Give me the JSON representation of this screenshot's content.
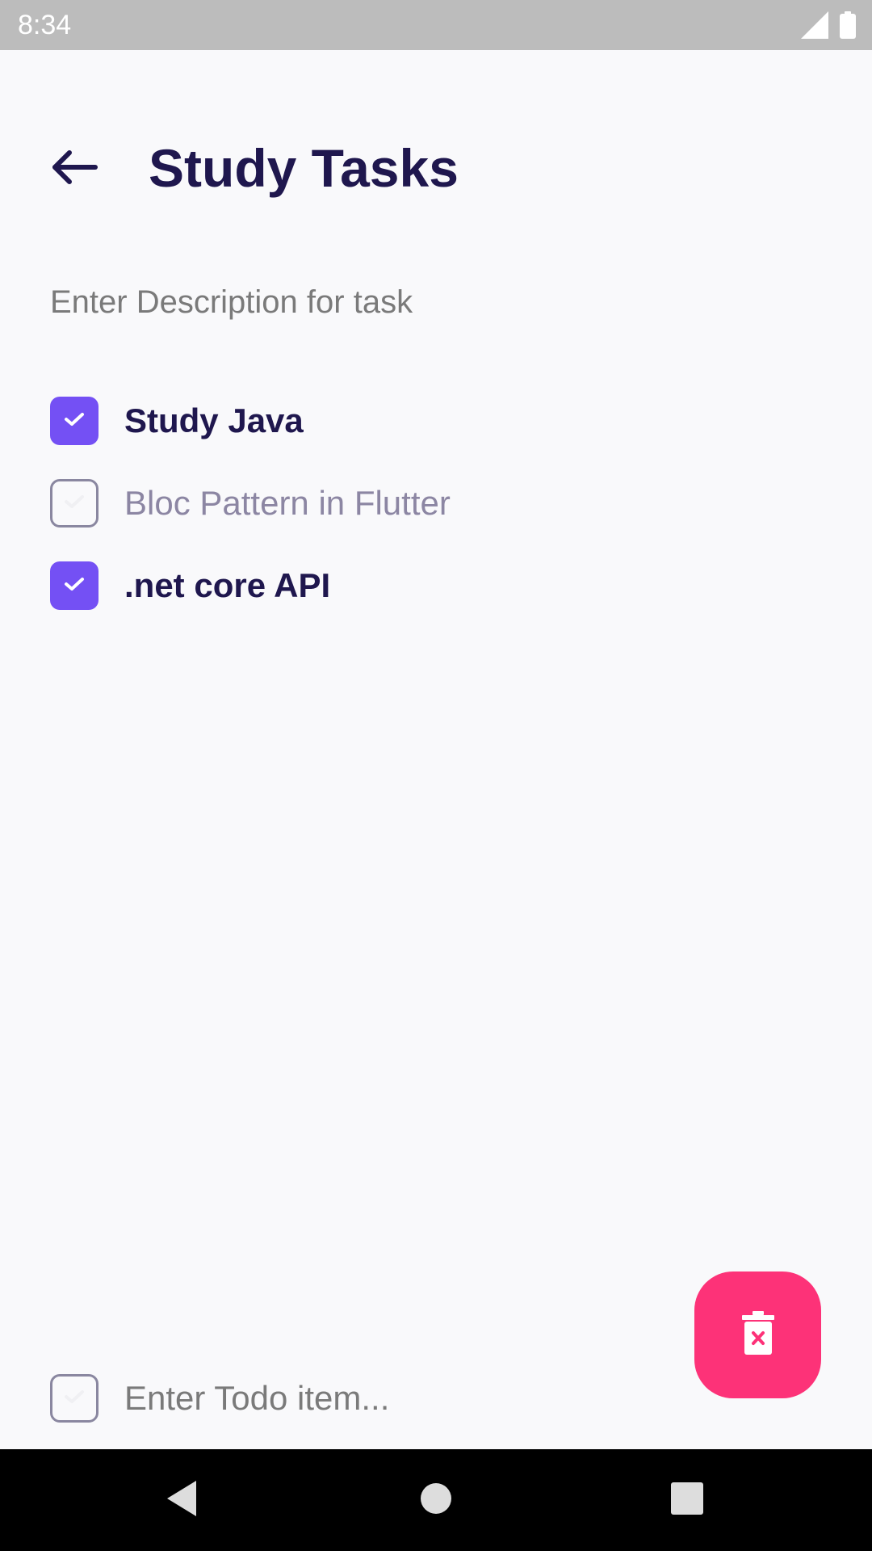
{
  "status_bar": {
    "time": "8:34",
    "icons": [
      "signal-icon",
      "battery-icon"
    ]
  },
  "header": {
    "back_icon": "arrow-left-icon",
    "title": "Study Tasks"
  },
  "description": {
    "placeholder": "Enter Description for task",
    "value": ""
  },
  "tasks": [
    {
      "label": "Study Java",
      "checked": true
    },
    {
      "label": "Bloc Pattern in Flutter",
      "checked": false
    },
    {
      "label": ".net core API",
      "checked": true
    }
  ],
  "fab": {
    "icon": "delete-icon"
  },
  "new_todo": {
    "placeholder": "Enter Todo item...",
    "checked": false
  },
  "nav_bar": {
    "icons": [
      "back-triangle-icon",
      "home-circle-icon",
      "recents-square-icon"
    ]
  },
  "colors": {
    "accent": "#7450F4",
    "title_text": "#1F174E",
    "fab": "#FD3278",
    "background": "#F9F9FB",
    "status_bar": "#BCBCBC"
  }
}
